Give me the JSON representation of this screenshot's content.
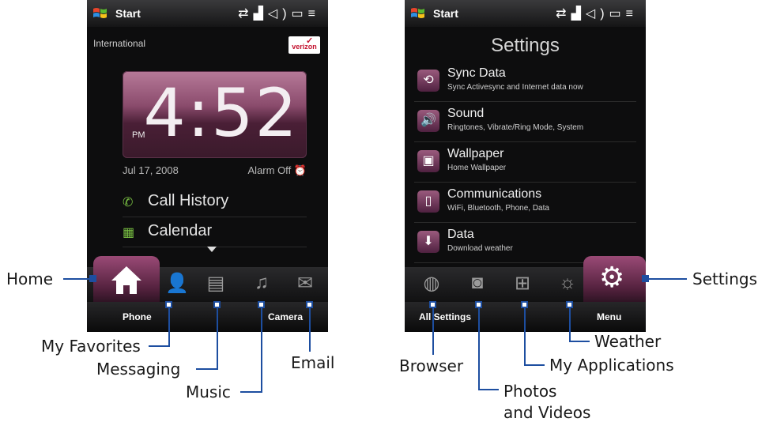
{
  "status_bar": {
    "start_label": "Start",
    "icons": [
      "sync-icon",
      "signal-icon",
      "speaker-icon",
      "battery-icon",
      "menu-icon"
    ]
  },
  "home": {
    "network_label": "International",
    "carrier_logo": "verizon",
    "clock": {
      "time": "4:52",
      "ampm": "PM"
    },
    "date": "Jul 17, 2008",
    "alarm": "Alarm Off",
    "items": [
      {
        "label": "Call History",
        "icon": "phone-call-icon"
      },
      {
        "label": "Calendar",
        "icon": "calendar-icon"
      }
    ],
    "softkeys": {
      "left": "Phone",
      "right": "Camera"
    }
  },
  "settings": {
    "title": "Settings",
    "items": [
      {
        "title": "Sync Data",
        "subtitle": "Sync Activesync and Internet data now",
        "icon": "sync-data-icon"
      },
      {
        "title": "Sound",
        "subtitle": "Ringtones, Vibrate/Ring Mode, System",
        "icon": "sound-icon"
      },
      {
        "title": "Wallpaper",
        "subtitle": "Home Wallpaper",
        "icon": "wallpaper-icon"
      },
      {
        "title": "Communications",
        "subtitle": "WiFi, Bluetooth, Phone, Data",
        "icon": "communications-icon"
      },
      {
        "title": "Data",
        "subtitle": "Download weather",
        "icon": "data-icon"
      }
    ],
    "softkeys": {
      "left": "All Settings",
      "right": "Menu"
    }
  },
  "callouts": {
    "home": "Home",
    "my_favorites": "My Favorites",
    "messaging": "Messaging",
    "music": "Music",
    "email": "Email",
    "settings": "Settings",
    "weather": "Weather",
    "browser": "Browser",
    "my_applications": "My Applications",
    "photos_videos_line1": "Photos",
    "photos_videos_line2": "and Videos"
  },
  "colors": {
    "accent": "#8a3f66",
    "callout_line": "#1d4ea0"
  }
}
